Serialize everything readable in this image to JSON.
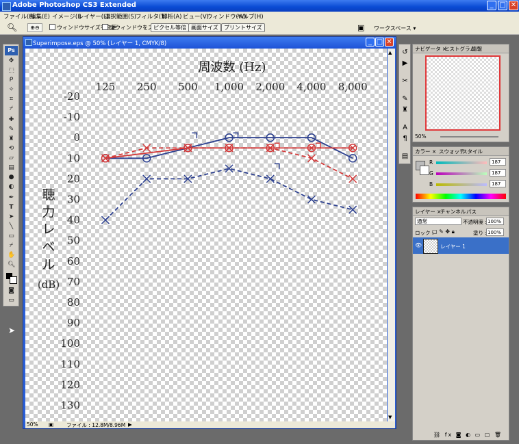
{
  "app": {
    "title": "Adobe Photoshop CS3 Extended",
    "icon": "photoshop-icon",
    "window_buttons": {
      "min": "_",
      "max": "□",
      "close": "✕"
    }
  },
  "menu": [
    "ファイル(F)",
    "編集(E)",
    "イメージ(I)",
    "レイヤー(L)",
    "選択範囲(S)",
    "フィルタ(T)",
    "解析(A)",
    "ビュー(V)",
    "ウィンドウ(W)",
    "ヘルプ(H)"
  ],
  "options_bar": {
    "zoom_tool_icon": "zoom-tool-icon",
    "resize_windows_label": "ウィンドウサイズを変更",
    "zoom_all_label": "全ウィンドウをズーム",
    "actual_pixels": "ピクセル等倍",
    "fit_screen": "画面サイズ",
    "print_size": "プリントサイズ",
    "workspace": "ワークスペース ▾"
  },
  "toolbox": {
    "logo": "Ps"
  },
  "document": {
    "title": "Superimpose.eps @ 50% (レイヤー 1, CMYK/8)",
    "zoom": "50%",
    "file_info": "ファイル : 12.8M/8.96M"
  },
  "chart_data": {
    "type": "line",
    "title": "周波数 (Hz)",
    "ylabel": "聴力レベル (dB)",
    "ylabel_chars": [
      "聴",
      "力",
      "レ",
      "ベ",
      "ル",
      "(dB)"
    ],
    "categories": [
      "125",
      "250",
      "500",
      "1,000",
      "2,000",
      "4,000",
      "8,000"
    ],
    "y_ticks": [
      "-20",
      "-10",
      "0",
      "10",
      "20",
      "30",
      "40",
      "50",
      "60",
      "70",
      "80",
      "90",
      "100",
      "110",
      "120",
      "130"
    ],
    "ylim": [
      -20,
      130
    ],
    "y_inverted": true,
    "series": [
      {
        "color": "#2b3f8f",
        "style": "solid",
        "marker": "circle",
        "values": [
          10,
          10,
          5,
          0,
          0,
          0,
          10
        ]
      },
      {
        "color": "#d33a3a",
        "style": "solid",
        "marker": "circle-x",
        "values": [
          10,
          null,
          5,
          5,
          5,
          5,
          5
        ]
      },
      {
        "color": "#d33a3a",
        "style": "dashed",
        "marker": "x",
        "values": [
          10,
          5,
          5,
          5,
          5,
          10,
          20
        ]
      },
      {
        "color": "#2b3f8f",
        "style": "dashed",
        "marker": "x",
        "values": [
          40,
          20,
          20,
          15,
          20,
          30,
          35
        ]
      }
    ],
    "bone_brackets": [
      {
        "x": "500",
        "y": -1,
        "color": "#2b3f8f"
      },
      {
        "x": "1,000",
        "y": -1,
        "color": "#2b3f8f"
      },
      {
        "x": "2,000",
        "y": 4,
        "color": "#d33a3a"
      },
      {
        "x": "4,000",
        "y": 4,
        "color": "#d33a3a"
      },
      {
        "x": "2,000",
        "y": 14,
        "color": "#2b3f8f"
      }
    ],
    "grid": false
  },
  "navigator": {
    "tabs": [
      "ナビゲータ ×",
      "ヒストグラム",
      "情報"
    ],
    "zoom": "50%"
  },
  "color_panel": {
    "tabs": [
      "カラー ×",
      "スウォッチ",
      "スタイル"
    ],
    "channels": [
      {
        "name": "R",
        "value": "187"
      },
      {
        "name": "G",
        "value": "187"
      },
      {
        "name": "B",
        "value": "187"
      }
    ]
  },
  "layers_panel": {
    "tabs": [
      "レイヤー ×",
      "チャンネル",
      "パス"
    ],
    "blend_mode": "通常",
    "opacity_label": "不透明度 :",
    "opacity": "100%",
    "lock_label": "ロック :",
    "fill_label": "塗り :",
    "fill": "100%",
    "layer_name": "レイヤー 1"
  }
}
